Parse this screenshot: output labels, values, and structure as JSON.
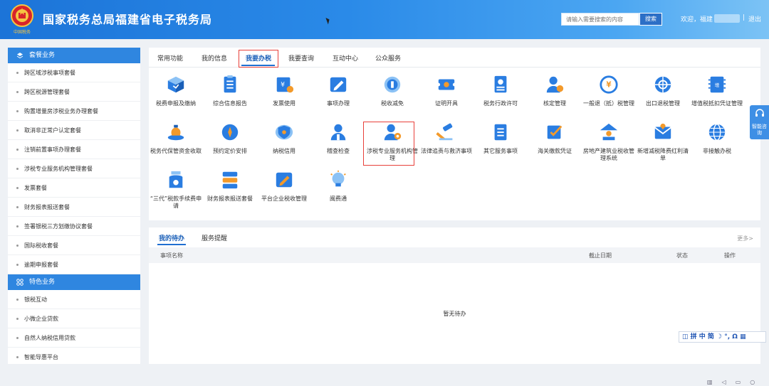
{
  "header": {
    "title": "国家税务总局福建省电子税务局",
    "search_placeholder": "请输入需要搜索的内容",
    "search_button": "搜索",
    "welcome": "欢迎，福建",
    "separator": "|",
    "logout": "退出",
    "emblem_caption": "中国税务"
  },
  "sidebar": {
    "sections": [
      {
        "title": "套餐业务",
        "items": [
          "跨区域涉税事项套餐",
          "跨区税源管理套餐",
          "购置增量房涉税业务办理套餐",
          "取消非正常户认定套餐",
          "注销前置事项办理套餐",
          "涉税专业服务机构管理套餐",
          "发票套餐",
          "财务报表报送套餐",
          "签署银税三方划缴协议套餐",
          "国际税收套餐",
          "逾期申报套餐"
        ]
      },
      {
        "title": "特色业务",
        "items": [
          "银税互动",
          "小微企业贷款",
          "自然人纳税信用贷款",
          "智能导惠平台"
        ]
      }
    ]
  },
  "tabs": [
    "常用功能",
    "我的信息",
    "我要办税",
    "我要查询",
    "互动中心",
    "公众服务"
  ],
  "active_tab": "我要办税",
  "functions": [
    {
      "label": "税费申报及缴纳",
      "icon": "box-icon"
    },
    {
      "label": "综合信息报告",
      "icon": "document-icon"
    },
    {
      "label": "发票使用",
      "icon": "invoice-icon"
    },
    {
      "label": "事项办理",
      "icon": "pen-icon"
    },
    {
      "label": "税收减免",
      "icon": "coin-icon"
    },
    {
      "label": "证明开具",
      "icon": "certificate-icon"
    },
    {
      "label": "税务行政许可",
      "icon": "id-card-icon"
    },
    {
      "label": "核定管理",
      "icon": "user-gear-icon"
    },
    {
      "label": "一般退（抵）税管理",
      "icon": "refund-icon"
    },
    {
      "label": "出口退税管理",
      "icon": "globe-icon"
    },
    {
      "label": "增值税抵扣凭证管理",
      "icon": "ticket-icon"
    },
    {
      "label": "税务代保管资金收取",
      "icon": "money-bag-icon"
    },
    {
      "label": "预约定价安排",
      "icon": "compass-icon"
    },
    {
      "label": "纳税信用",
      "icon": "shield-icon"
    },
    {
      "label": "稽查检查",
      "icon": "inspector-icon"
    },
    {
      "label": "涉税专业服务机构管理",
      "icon": "agent-icon"
    },
    {
      "label": "法律追责与救济事项",
      "icon": "gavel-icon"
    },
    {
      "label": "其它服务事项",
      "icon": "list-icon"
    },
    {
      "label": "海关缴款凭证",
      "icon": "checkbox-icon"
    },
    {
      "label": "房地产建筑业税收管理系统",
      "icon": "building-user-icon"
    },
    {
      "label": "新增减税降费红利清单",
      "icon": "mail-icon"
    },
    {
      "label": "非接触办税",
      "icon": "network-globe-icon"
    },
    {
      "label": "“三代”税款手续费申请",
      "icon": "bag-icon"
    },
    {
      "label": "财务报表报送套餐",
      "icon": "server-icon"
    },
    {
      "label": "平台企业税收管理",
      "icon": "edit-icon"
    },
    {
      "label": "闽费通",
      "icon": "bulb-icon"
    }
  ],
  "todo": {
    "tabs": [
      "我的待办",
      "服务提醒"
    ],
    "more": "更多>",
    "columns": [
      "事项名称",
      "截止日期",
      "状态",
      "操作"
    ],
    "empty": "暂无待办"
  },
  "float_ai": "智能咨询",
  "ime_bar": "拼 中 简 ☽ °, Ω",
  "colors": {
    "header": "#1c74d8",
    "accent": "#2f86e0",
    "highlight": "#e8403a",
    "icon_blue": "#2a7de1"
  }
}
